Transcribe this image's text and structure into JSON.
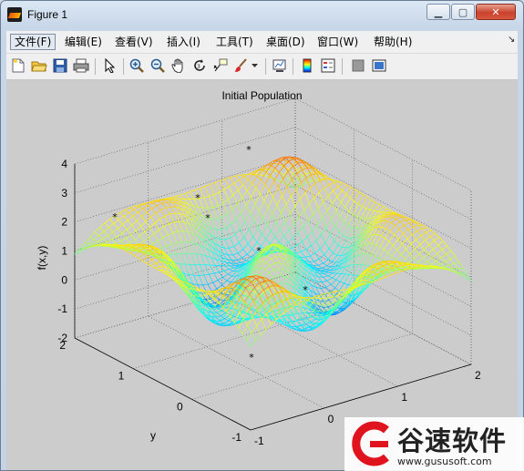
{
  "window": {
    "title": "Figure 1"
  },
  "menu": {
    "items": [
      "文件(F)",
      "编辑(E)",
      "查看(V)",
      "插入(I)",
      "工具(T)",
      "桌面(D)",
      "窗口(W)",
      "帮助(H)"
    ]
  },
  "toolbar": {
    "icons": [
      "new-figure-icon",
      "open-file-icon",
      "save-icon",
      "print-icon",
      "select-arrow-icon",
      "zoom-in-icon",
      "zoom-out-icon",
      "pan-hand-icon",
      "rotate-3d-icon",
      "data-cursor-icon",
      "brush-icon",
      "link-plot-icon",
      "colorbar-icon",
      "legend-icon",
      "hide-plot-tools-icon",
      "show-plot-tools-icon"
    ]
  },
  "chart_data": {
    "type": "surface-3d-mesh",
    "title": "Initial Population",
    "zlabel": "f(x,y)",
    "ylabel": "y",
    "xlabel": "",
    "x_ticks": [
      "-1",
      "0",
      "1",
      "2"
    ],
    "y_ticks": [
      "-1",
      "0",
      "1",
      "2"
    ],
    "z_ticks": [
      "-2",
      "-1",
      "0",
      "1",
      "2",
      "3",
      "4"
    ],
    "xlim": [
      -1,
      2
    ],
    "ylim": [
      -1,
      2
    ],
    "zlim": [
      -2,
      4
    ],
    "grid": true,
    "colormap": "jet",
    "surface": "mesh of f(x,y) over x in [-1,2], y in [-1,2] — oscillating peaks and valleys",
    "population_markers": "9 black star markers (initial population points)"
  },
  "watermark": {
    "brand_cn": "谷速软件",
    "url": "www.gususoft.com",
    "brand_color": "#e0141e"
  }
}
